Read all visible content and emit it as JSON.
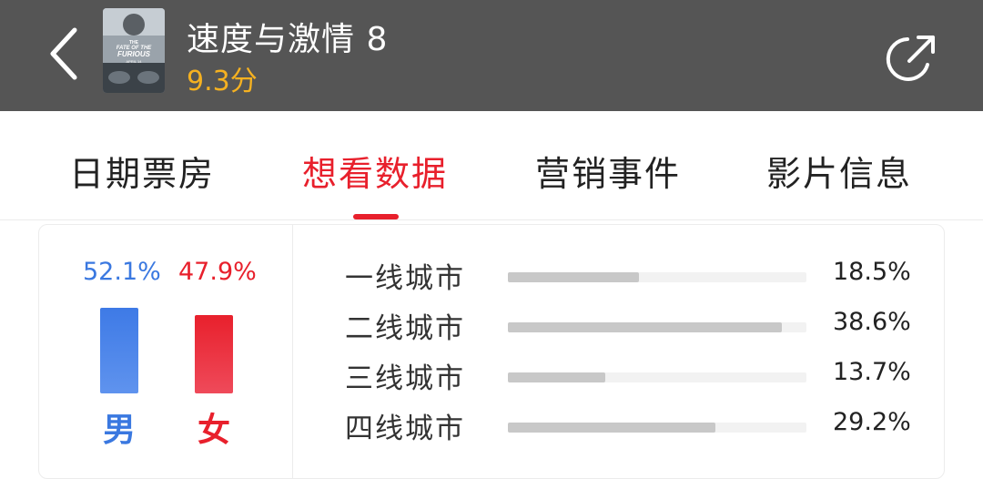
{
  "header": {
    "back_icon": "chevron-left-icon",
    "movie_title": "速度与激情 8",
    "score": "9.3分",
    "poster_lines": [
      "THE",
      "FATE OF THE",
      "FURIOUS",
      "APRIL 14"
    ],
    "share_icon": "share-icon",
    "bar_color": "#555555",
    "score_color": "#f5b121"
  },
  "tabs": [
    {
      "label": "日期票房",
      "active": false
    },
    {
      "label": "想看数据",
      "active": true
    },
    {
      "label": "营销事件",
      "active": false
    },
    {
      "label": "影片信息",
      "active": false
    }
  ],
  "accent_color": "#e8202c",
  "gender": {
    "male": {
      "label": "男",
      "percent": "52.1%",
      "value": 52.1,
      "color": "#3a78e0"
    },
    "female": {
      "label": "女",
      "percent": "47.9%",
      "value": 47.9,
      "color": "#e8202c"
    }
  },
  "city_tiers": [
    {
      "name": "一线城市",
      "percent": "18.5%",
      "value": 18.5
    },
    {
      "name": "二线城市",
      "percent": "38.6%",
      "value": 38.6
    },
    {
      "name": "三线城市",
      "percent": "13.7%",
      "value": 13.7
    },
    {
      "name": "四线城市",
      "percent": "29.2%",
      "value": 29.2
    }
  ]
}
